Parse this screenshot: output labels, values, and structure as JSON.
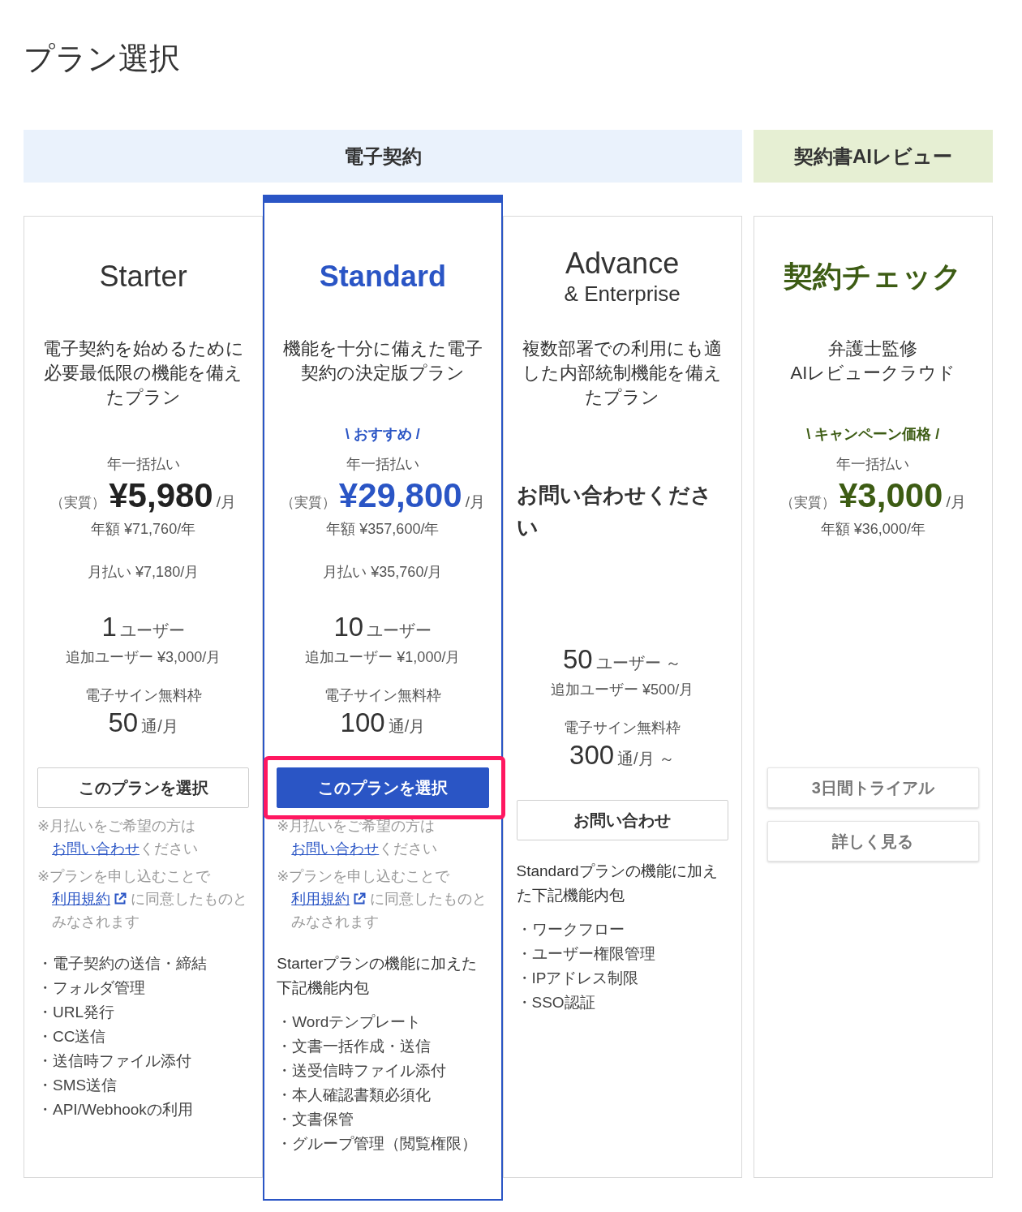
{
  "title": "プラン選択",
  "groups": [
    {
      "label": "電子契約",
      "color": "#eaf2fc",
      "plans": [
        {
          "name": "Starter",
          "featured": false,
          "description": "電子契約を始めるために必要最低限の機能を備えたプラン",
          "offer": {
            "kind": "price",
            "billing": "年一括払い",
            "price_prefix": "（実質）",
            "price": "¥5,980",
            "price_unit": "/月",
            "annual": "年額 ¥71,760/年",
            "monthly": "月払い ¥7,180/月"
          },
          "users": {
            "count": "1",
            "unit": "ユーザー"
          },
          "extra_user": "追加ユーザー ¥3,000/月",
          "signatures": {
            "label": "電子サイン無料枠",
            "count": "50",
            "unit": "通/月"
          },
          "buttons": [
            {
              "label": "このプランを選択",
              "kind": "outline",
              "highlighted": false
            }
          ],
          "notes": [
            {
              "text": "※月払いをご希望の方は",
              "link": "お問い合わせ",
              "external": false,
              "after": "ください"
            },
            {
              "text": "※プランを申し込むことで ",
              "link": "利用規約",
              "external": true,
              "after": " に同意したものとみなされます"
            }
          ],
          "features": [
            "・電子契約の送信・締結",
            "・フォルダ管理",
            "・URL発行",
            "・CC送信",
            "・送信時ファイル添付",
            "・SMS送信",
            "・API/Webhookの利用"
          ]
        },
        {
          "name": "Standard",
          "featured": true,
          "color": "#2a55c5",
          "description": "機能を十分に備えた電子契約の決定版プラン",
          "offer": {
            "kind": "price",
            "badge": "\\ おすすめ /",
            "billing": "年一括払い",
            "price_prefix": "（実質）",
            "price": "¥29,800",
            "price_unit": "/月",
            "annual": "年額 ¥357,600/年",
            "monthly": "月払い ¥35,760/月"
          },
          "users": {
            "count": "10",
            "unit": "ユーザー"
          },
          "extra_user": "追加ユーザー ¥1,000/月",
          "signatures": {
            "label": "電子サイン無料枠",
            "count": "100",
            "unit": "通/月"
          },
          "buttons": [
            {
              "label": "このプランを選択",
              "kind": "primary",
              "highlighted": true
            }
          ],
          "notes": [
            {
              "text": "※月払いをご希望の方は",
              "link": "お問い合わせ",
              "external": false,
              "after": "ください"
            },
            {
              "text": "※プランを申し込むことで ",
              "link": "利用規約",
              "external": true,
              "after": " に同意したものとみなされます"
            }
          ],
          "features_intro": "Starterプランの機能に加えた下記機能内包",
          "features": [
            "・Wordテンプレート",
            "・文書一括作成・送信",
            "・送受信時ファイル添付",
            "・本人確認書類必須化",
            "・文書保管",
            "・グループ管理（閲覧権限）"
          ]
        },
        {
          "name": "Advance",
          "subname": "& Enterprise",
          "featured": false,
          "description": "複数部署での利用にも適した内部統制機能を備えたプラン",
          "offer": {
            "kind": "contact",
            "text": "お問い合わせください"
          },
          "users": {
            "count": "50",
            "unit": "ユーザー ～"
          },
          "extra_user": "追加ユーザー ¥500/月",
          "signatures": {
            "label": "電子サイン無料枠",
            "count": "300",
            "unit": "通/月 ～"
          },
          "buttons": [
            {
              "label": "お問い合わせ",
              "kind": "outline",
              "highlighted": false
            }
          ],
          "features_intro": "Standardプランの機能に加えた下記機能内包",
          "features": [
            "・ワークフロー",
            "・ユーザー権限管理",
            "・IPアドレス制限",
            "・SSO認証"
          ]
        }
      ]
    },
    {
      "label": "契約書AIレビュー",
      "color": "#e6efd3",
      "plans": [
        {
          "name": "契約チェック",
          "featured": false,
          "color": "#3d5c14",
          "description": "弁護士監修\nAIレビュークラウド",
          "offer": {
            "kind": "price",
            "badge": "\\ キャンペーン価格 /",
            "billing": "年一括払い",
            "price_prefix": "（実質）",
            "price": "¥3,000",
            "price_unit": "/月",
            "annual": "年額 ¥36,000/年"
          },
          "buttons": [
            {
              "label": "3日間トライアル",
              "kind": "soft",
              "highlighted": false
            },
            {
              "label": "詳しく見る",
              "kind": "soft",
              "highlighted": false
            }
          ]
        }
      ]
    }
  ]
}
